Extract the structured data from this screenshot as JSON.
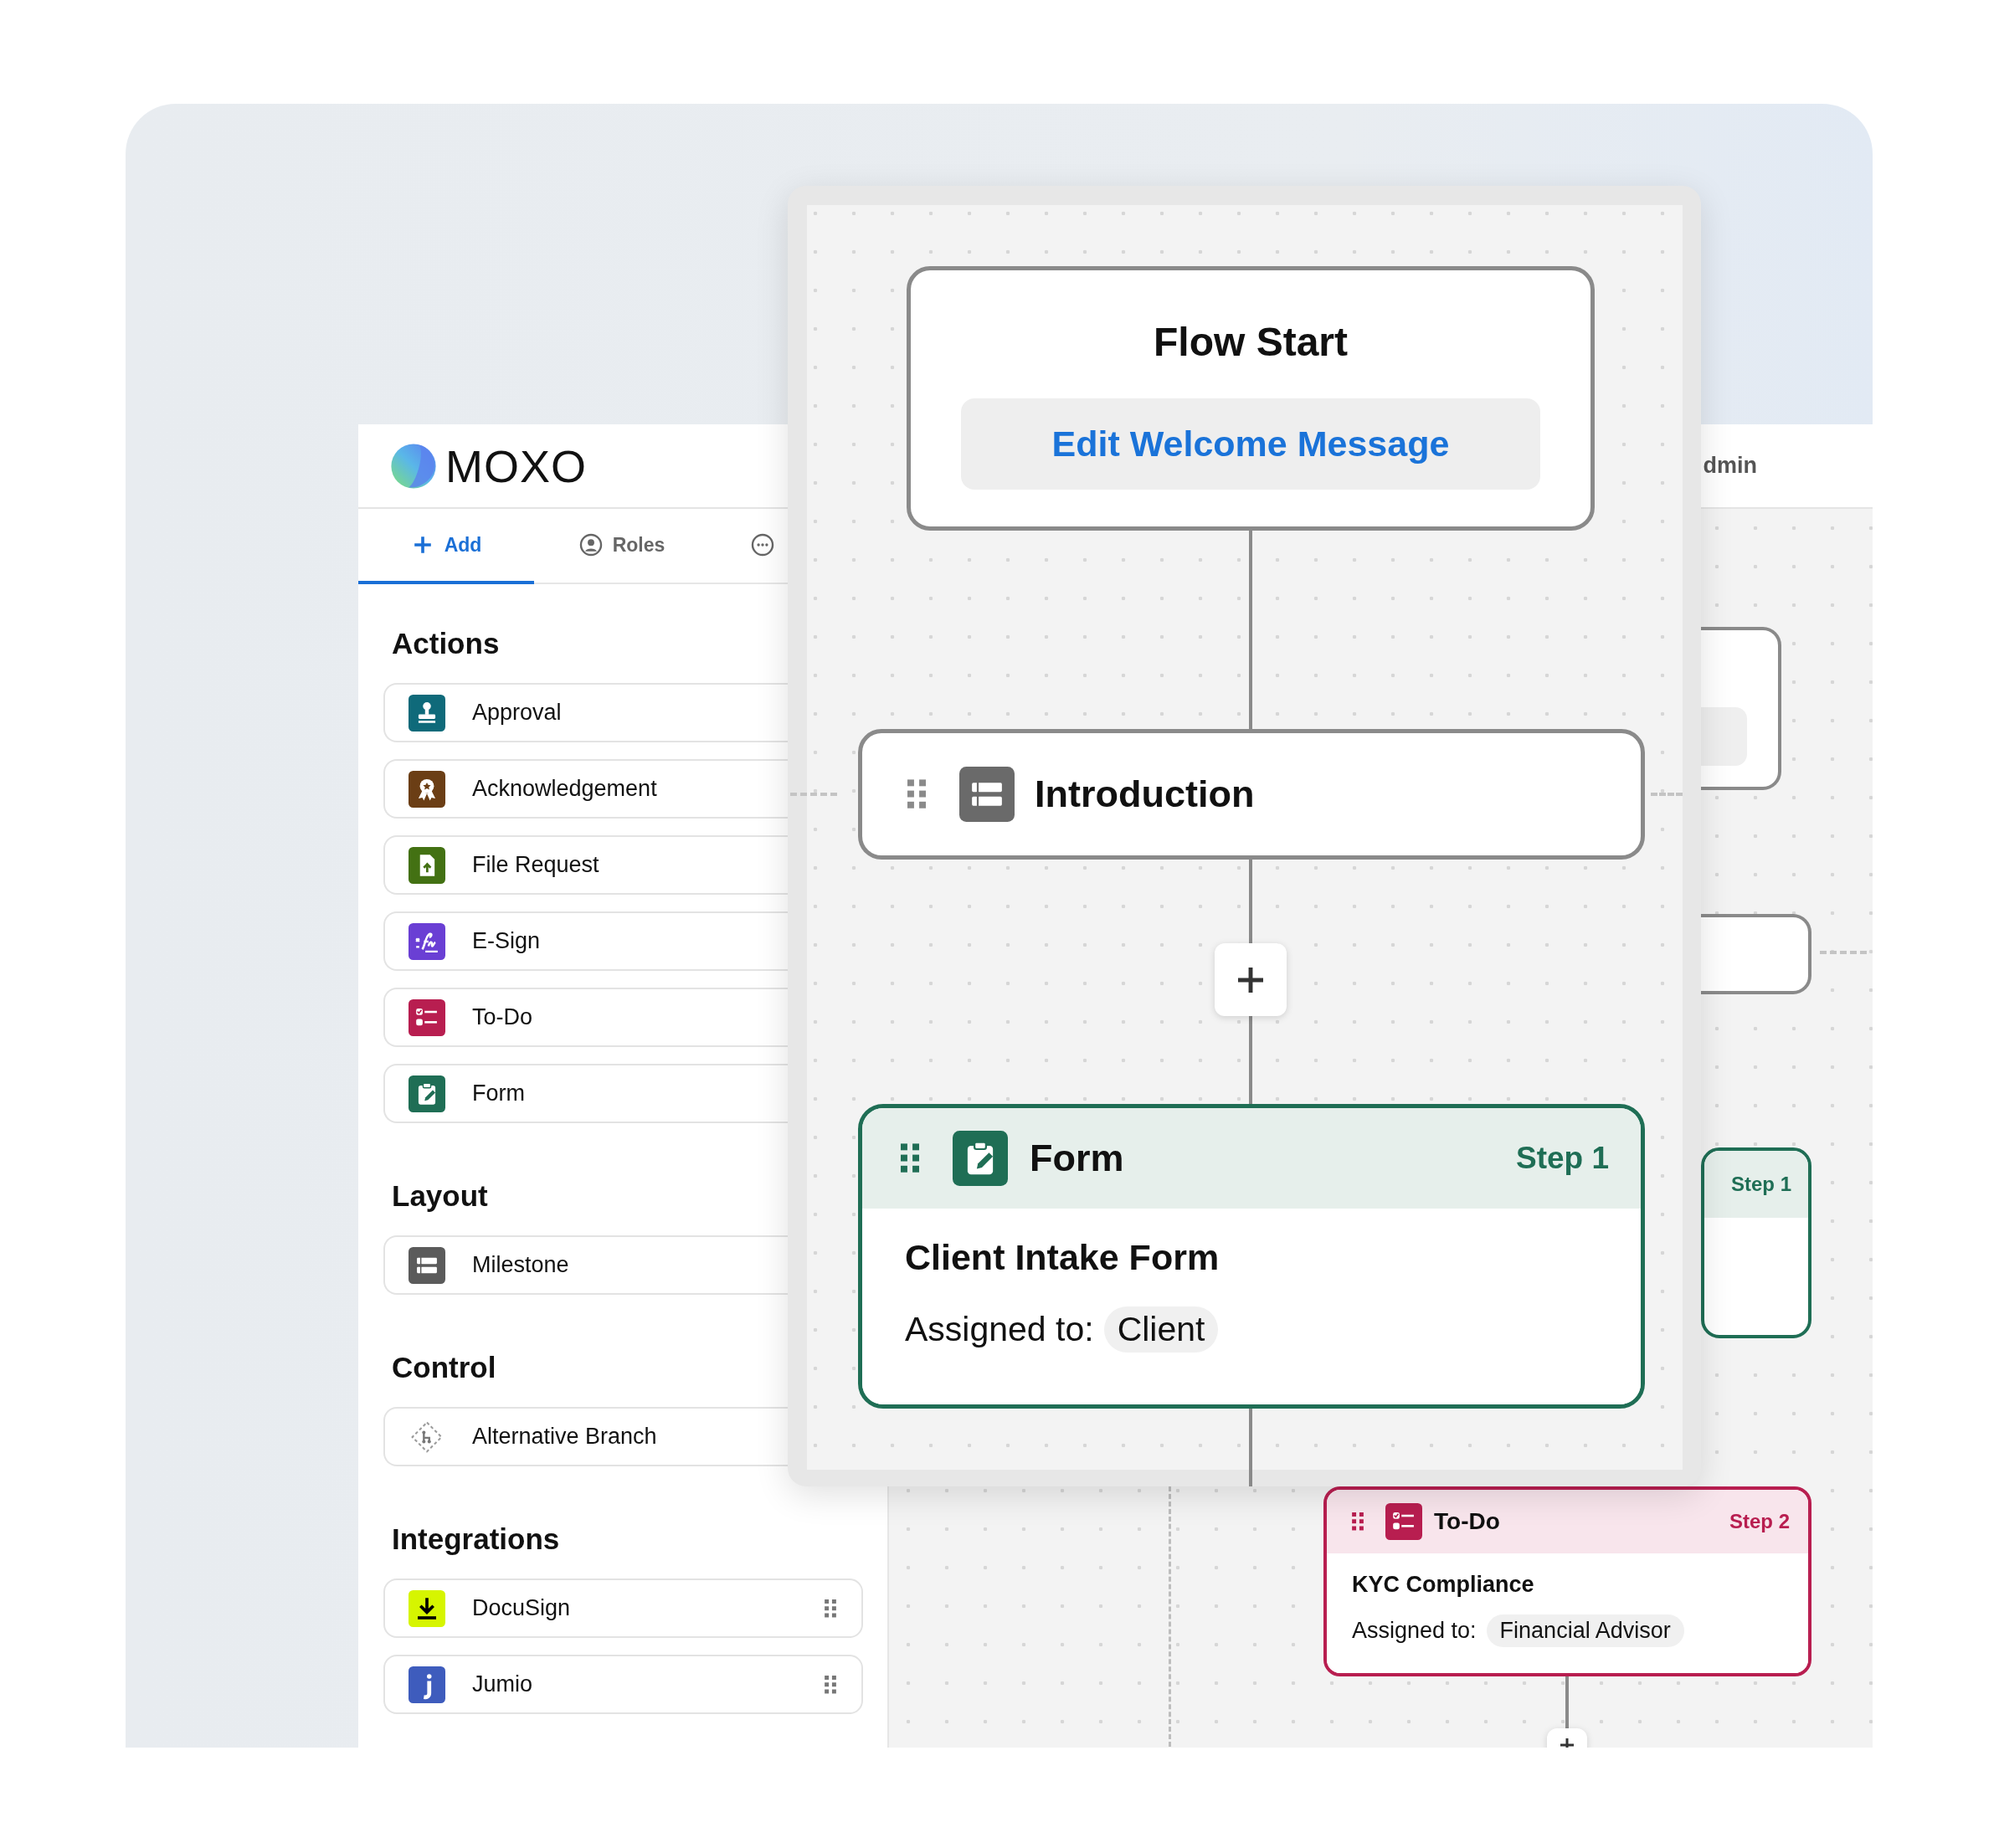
{
  "logo": {
    "wordmark": "MOXO"
  },
  "header": {
    "account_label": "dmin"
  },
  "tabs": [
    {
      "kind": "add",
      "label": "Add",
      "selected": true
    },
    {
      "kind": "roles",
      "label": "Roles",
      "selected": false
    },
    {
      "kind": "more",
      "selected": false
    }
  ],
  "sidebar": {
    "sections": [
      {
        "title": "Actions",
        "items": [
          {
            "kind": "approval",
            "label": "Approval",
            "color": "#0f6a7a"
          },
          {
            "kind": "acknowledgement",
            "label": "Acknowledgement",
            "color": "#6b3e15"
          },
          {
            "kind": "file-request",
            "label": "File Request",
            "color": "#437113"
          },
          {
            "kind": "esign",
            "label": "E-Sign",
            "color": "#6a3fd4"
          },
          {
            "kind": "todo",
            "label": "To-Do",
            "color": "#b81e50"
          },
          {
            "kind": "form",
            "label": "Form",
            "color": "#1f6e55"
          }
        ]
      },
      {
        "title": "Layout",
        "items": [
          {
            "kind": "milestone",
            "label": "Milestone",
            "color": "#5b5b5b"
          }
        ]
      },
      {
        "title": "Control",
        "items": [
          {
            "kind": "branch",
            "label": "Alternative Branch",
            "color": "#9a9a9a"
          }
        ]
      },
      {
        "title": "Integrations",
        "items": [
          {
            "kind": "docusign",
            "label": "DocuSign",
            "color": "#d6f500",
            "drag_handle": true
          },
          {
            "kind": "jumio",
            "label": "Jumio",
            "color": "#3e5cbd",
            "drag_handle": true
          }
        ]
      }
    ]
  },
  "zoom_view": {
    "flow_start": {
      "title": "Flow Start",
      "button": "Edit Welcome Message"
    },
    "milestone": {
      "title": "Introduction"
    },
    "step": {
      "kind": "form",
      "type": "Form",
      "step": "Step 1",
      "title": "Client Intake Form",
      "assigned_label": "Assigned to:",
      "assignee": "Client"
    }
  },
  "background_canvas": {
    "partial_step_label": "Step 1",
    "step": {
      "kind": "todo",
      "type": "To-Do",
      "step": "Step 2",
      "title": "KYC Compliance",
      "assigned_label": "Assigned to:",
      "assignee": "Financial Advisor"
    }
  }
}
